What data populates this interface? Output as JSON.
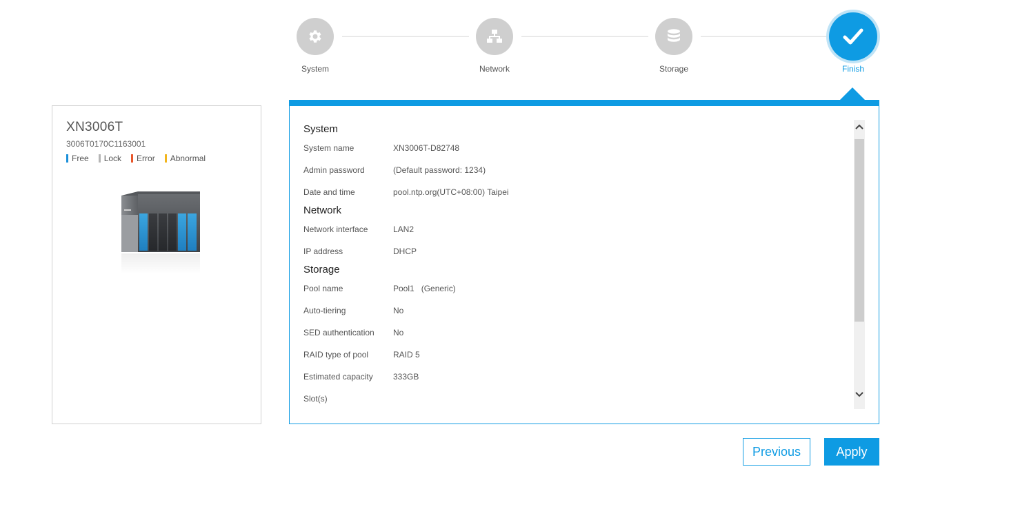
{
  "stepper": {
    "steps": [
      {
        "label": "System",
        "icon": "gear-icon",
        "state": "done"
      },
      {
        "label": "Network",
        "icon": "network-icon",
        "state": "done"
      },
      {
        "label": "Storage",
        "icon": "database-icon",
        "state": "done"
      },
      {
        "label": "Finish",
        "icon": "check-icon",
        "state": "active"
      }
    ]
  },
  "device": {
    "model": "XN3006T",
    "serial": "3006T0170C1163001",
    "legend": [
      {
        "label": "Free",
        "color": "#1a8fd9"
      },
      {
        "label": "Lock",
        "color": "#b5b5b5"
      },
      {
        "label": "Error",
        "color": "#e8562a"
      },
      {
        "label": "Abnormal",
        "color": "#f2b51d"
      }
    ]
  },
  "summary": {
    "system": {
      "title": "System",
      "rows": [
        {
          "label": "System name",
          "value": "XN3006T-D82748"
        },
        {
          "label": "Admin password",
          "value": "(Default password: 1234)"
        },
        {
          "label": "Date and time",
          "value": "pool.ntp.org(UTC+08:00) Taipei"
        }
      ]
    },
    "network": {
      "title": "Network",
      "rows": [
        {
          "label": "Network interface",
          "value": "LAN2"
        },
        {
          "label": "IP address",
          "value": "DHCP"
        }
      ]
    },
    "storage": {
      "title": "Storage",
      "rows": [
        {
          "label": "Pool name",
          "value": "Pool1   (Generic)"
        },
        {
          "label": "Auto-tiering",
          "value": "No"
        },
        {
          "label": "SED authentication",
          "value": "No"
        },
        {
          "label": "RAID type of pool",
          "value": "RAID 5"
        },
        {
          "label": "Estimated capacity",
          "value": "333GB"
        },
        {
          "label": "Slot(s)",
          "value": ""
        }
      ]
    }
  },
  "buttons": {
    "previous": "Previous",
    "apply": "Apply"
  },
  "colors": {
    "accent": "#0e9be3",
    "inactive_step": "#cfcfcf"
  }
}
